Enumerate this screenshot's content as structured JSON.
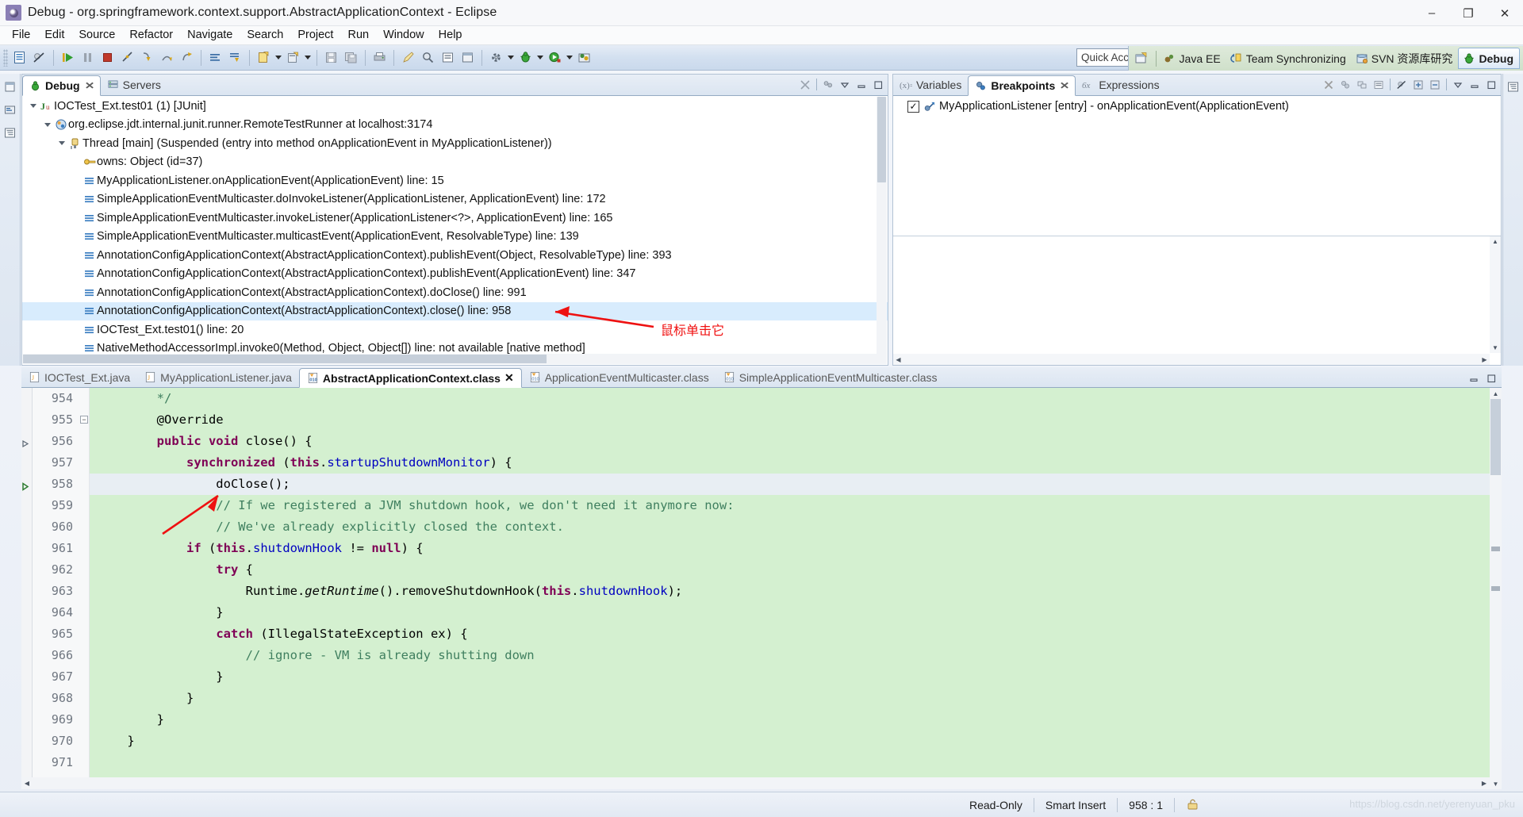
{
  "window": {
    "title": "Debug - org.springframework.context.support.AbstractApplicationContext - Eclipse",
    "app_icon": "eclipse-icon",
    "minimize": "minimize-icon",
    "maximize": "maximize-icon",
    "close": "close-icon",
    "min_glyph": "–",
    "max_glyph": "❐",
    "close_glyph": "✕"
  },
  "menu": {
    "items": [
      {
        "label": "File"
      },
      {
        "label": "Edit"
      },
      {
        "label": "Source"
      },
      {
        "label": "Refactor"
      },
      {
        "label": "Navigate"
      },
      {
        "label": "Search"
      },
      {
        "label": "Project"
      },
      {
        "label": "Run"
      },
      {
        "label": "Window"
      },
      {
        "label": "Help"
      }
    ]
  },
  "toolbar": {
    "quick_access": "Quick Access",
    "quick_access_placeholder": "Quick Access",
    "buttons": [
      {
        "name": "new-wizard-button",
        "icon": "new-file-icon"
      },
      {
        "name": "skip-breakpoints-button",
        "icon": "skip-breakpoints-icon"
      },
      {
        "name": "resume-button",
        "icon": "resume-icon"
      },
      {
        "name": "suspend-button",
        "icon": "suspend-icon"
      },
      {
        "name": "terminate-button",
        "icon": "terminate-stop-icon"
      },
      {
        "name": "disconnect-button",
        "icon": "disconnect-icon"
      },
      {
        "name": "step-into-button",
        "icon": "step-into-icon"
      },
      {
        "name": "step-over-button",
        "icon": "step-over-icon"
      },
      {
        "name": "step-return-button",
        "icon": "step-return-icon"
      },
      {
        "name": "align-button",
        "icon": "lines-icon"
      },
      {
        "name": "drop-to-frame-button",
        "icon": "drop-to-frame-icon"
      },
      {
        "name": "new-java-class-button",
        "icon": "new-class-icon"
      },
      {
        "name": "new-java-package-button",
        "icon": "new-package-icon"
      },
      {
        "name": "save-button",
        "icon": "save-disk-icon"
      },
      {
        "name": "save-all-button",
        "icon": "save-all-icon"
      },
      {
        "name": "print-button",
        "icon": "print-icon"
      },
      {
        "name": "quick-fix-button",
        "icon": "pencil-icon"
      },
      {
        "name": "search-button",
        "icon": "search-icon"
      },
      {
        "name": "open-task-button",
        "icon": "task-icon"
      },
      {
        "name": "open-type-button",
        "icon": "type-icon"
      },
      {
        "name": "debug-launch-button",
        "icon": "debug-bug-icon"
      },
      {
        "name": "run-launch-button",
        "icon": "run-green-play-icon"
      },
      {
        "name": "external-tools-button",
        "icon": "external-tools-icon"
      },
      {
        "name": "open-perspective-button",
        "icon": "open-perspective-icon"
      }
    ]
  },
  "perspectives": {
    "open_button": "open-perspective-icon",
    "items": [
      {
        "label": "Java EE",
        "icon": "java-ee-icon",
        "active": false
      },
      {
        "label": "Team Synchronizing",
        "icon": "team-sync-icon",
        "active": false
      },
      {
        "label": "SVN 资源库研究",
        "icon": "svn-repo-icon",
        "active": false
      },
      {
        "label": "Debug",
        "icon": "debug-bug-icon",
        "active": true
      }
    ]
  },
  "fast_view_bar": {
    "buttons": [
      {
        "name": "restore-view-icon"
      },
      {
        "name": "package-explorer-icon"
      },
      {
        "name": "outline-icon"
      }
    ]
  },
  "right_bar": {
    "buttons": [
      {
        "name": "outline-view-icon"
      }
    ]
  },
  "debug_view": {
    "tabs": [
      {
        "label": "Debug",
        "icon": "debug-bug-icon",
        "active": true,
        "closeable": true
      },
      {
        "label": "Servers",
        "icon": "servers-icon",
        "active": false,
        "closeable": false
      }
    ],
    "tools": [
      {
        "name": "collapse-all-icon"
      },
      {
        "name": "view-menu-icon"
      },
      {
        "name": "minimize-view-icon"
      },
      {
        "name": "maximize-view-icon"
      }
    ],
    "tree": [
      {
        "indent": 0,
        "twisty": "open",
        "icon": "junit-launch-icon",
        "label": "IOCTest_Ext.test01 (1) [JUnit]",
        "selected": false
      },
      {
        "indent": 1,
        "twisty": "open",
        "icon": "java-process-icon",
        "label": "org.eclipse.jdt.internal.junit.runner.RemoteTestRunner at localhost:3174",
        "selected": false
      },
      {
        "indent": 2,
        "twisty": "open",
        "icon": "thread-suspended-icon",
        "label": "Thread [main] (Suspended (entry into method onApplicationEvent in MyApplicationListener))",
        "selected": false
      },
      {
        "indent": 3,
        "twisty": "none",
        "icon": "monitor-owns-icon",
        "label": "owns: Object  (id=37)",
        "selected": false
      },
      {
        "indent": 3,
        "twisty": "none",
        "icon": "stack-frame-icon",
        "label": "MyApplicationListener.onApplicationEvent(ApplicationEvent) line: 15",
        "selected": false
      },
      {
        "indent": 3,
        "twisty": "none",
        "icon": "stack-frame-icon",
        "label": "SimpleApplicationEventMulticaster.doInvokeListener(ApplicationListener, ApplicationEvent) line: 172",
        "selected": false
      },
      {
        "indent": 3,
        "twisty": "none",
        "icon": "stack-frame-icon",
        "label": "SimpleApplicationEventMulticaster.invokeListener(ApplicationListener<?>, ApplicationEvent) line: 165",
        "selected": false
      },
      {
        "indent": 3,
        "twisty": "none",
        "icon": "stack-frame-icon",
        "label": "SimpleApplicationEventMulticaster.multicastEvent(ApplicationEvent, ResolvableType) line: 139",
        "selected": false
      },
      {
        "indent": 3,
        "twisty": "none",
        "icon": "stack-frame-icon",
        "label": "AnnotationConfigApplicationContext(AbstractApplicationContext).publishEvent(Object, ResolvableType) line: 393",
        "selected": false
      },
      {
        "indent": 3,
        "twisty": "none",
        "icon": "stack-frame-icon",
        "label": "AnnotationConfigApplicationContext(AbstractApplicationContext).publishEvent(ApplicationEvent) line: 347",
        "selected": false
      },
      {
        "indent": 3,
        "twisty": "none",
        "icon": "stack-frame-icon",
        "label": "AnnotationConfigApplicationContext(AbstractApplicationContext).doClose() line: 991",
        "selected": false
      },
      {
        "indent": 3,
        "twisty": "none",
        "icon": "stack-frame-icon",
        "label": "AnnotationConfigApplicationContext(AbstractApplicationContext).close() line: 958",
        "selected": true
      },
      {
        "indent": 3,
        "twisty": "none",
        "icon": "stack-frame-icon",
        "label": "IOCTest_Ext.test01() line: 20",
        "selected": false
      },
      {
        "indent": 3,
        "twisty": "none",
        "icon": "stack-frame-icon",
        "label": "NativeMethodAccessorImpl.invoke0(Method, Object, Object[]) line: not available [native method]",
        "selected": false
      }
    ]
  },
  "breakpoints_view": {
    "tabs": [
      {
        "label": "Variables",
        "icon": "variables-icon",
        "active": false,
        "closeable": false
      },
      {
        "label": "Breakpoints",
        "icon": "breakpoints-icon",
        "active": true,
        "closeable": true
      },
      {
        "label": "Expressions",
        "icon": "expressions-icon",
        "active": false,
        "closeable": false
      }
    ],
    "tools": [
      {
        "name": "remove-breakpoint-icon"
      },
      {
        "name": "remove-all-breakpoints-icon"
      },
      {
        "name": "link-with-debug-view-icon"
      },
      {
        "name": "breakpoint-group-icon"
      },
      {
        "name": "skip-all-breakpoints-icon"
      },
      {
        "name": "expand-all-icon"
      },
      {
        "name": "collapse-all-icon"
      },
      {
        "name": "view-menu-icon"
      },
      {
        "name": "minimize-view-icon"
      },
      {
        "name": "maximize-view-icon"
      }
    ],
    "items": [
      {
        "checked": true,
        "check_glyph": "✓",
        "icon": "method-breakpoint-icon",
        "label": "MyApplicationListener [entry] - onApplicationEvent(ApplicationEvent)"
      }
    ]
  },
  "editor": {
    "tabs": [
      {
        "label": "IOCTest_Ext.java",
        "icon": "java-file-icon",
        "active": false,
        "closeable": false
      },
      {
        "label": "MyApplicationListener.java",
        "icon": "java-file-icon",
        "active": false,
        "closeable": false
      },
      {
        "label": "AbstractApplicationContext.class",
        "icon": "class-file-icon",
        "active": true,
        "closeable": true
      },
      {
        "label": "ApplicationEventMulticaster.class",
        "icon": "class-file-icon",
        "active": false,
        "closeable": false
      },
      {
        "label": "SimpleApplicationEventMulticaster.class",
        "icon": "class-file-icon",
        "active": false,
        "closeable": false
      }
    ],
    "tools": [
      {
        "name": "minimize-editor-icon"
      },
      {
        "name": "maximize-editor-icon"
      }
    ],
    "first_line": 954,
    "current_line": 958,
    "lines": [
      {
        "no": 954,
        "fold": "none",
        "marker": "none",
        "tokens": [
          {
            "t": "        ",
            "c": "pl"
          },
          {
            "t": "*/",
            "c": "cm"
          }
        ]
      },
      {
        "no": 955,
        "fold": "minus",
        "marker": "none",
        "tokens": [
          {
            "t": "        @Override",
            "c": "pl"
          }
        ]
      },
      {
        "no": 956,
        "fold": "none",
        "marker": "collapse",
        "tokens": [
          {
            "t": "        ",
            "c": "pl"
          },
          {
            "t": "public void ",
            "c": "kw"
          },
          {
            "t": "close() {",
            "c": "pl"
          }
        ]
      },
      {
        "no": 957,
        "fold": "none",
        "marker": "none",
        "tokens": [
          {
            "t": "            ",
            "c": "pl"
          },
          {
            "t": "synchronized ",
            "c": "kw"
          },
          {
            "t": "(",
            "c": "pl"
          },
          {
            "t": "this",
            "c": "kw"
          },
          {
            "t": ".",
            "c": "pl"
          },
          {
            "t": "startupShutdownMonitor",
            "c": "fld"
          },
          {
            "t": ") {",
            "c": "pl"
          }
        ]
      },
      {
        "no": 958,
        "fold": "none",
        "marker": "arrow",
        "current": true,
        "tokens": [
          {
            "t": "                doClose();",
            "c": "pl"
          }
        ]
      },
      {
        "no": 959,
        "fold": "none",
        "marker": "none",
        "tokens": [
          {
            "t": "                ",
            "c": "pl"
          },
          {
            "t": "// If we registered a JVM shutdown hook, we don't need it anymore now:",
            "c": "cm"
          }
        ]
      },
      {
        "no": 960,
        "fold": "none",
        "marker": "none",
        "tokens": [
          {
            "t": "                ",
            "c": "pl"
          },
          {
            "t": "// We've already explicitly closed the context.",
            "c": "cm"
          }
        ]
      },
      {
        "no": 961,
        "fold": "none",
        "marker": "none",
        "tokens": [
          {
            "t": "            ",
            "c": "pl"
          },
          {
            "t": "if ",
            "c": "kw"
          },
          {
            "t": "(",
            "c": "pl"
          },
          {
            "t": "this",
            "c": "kw"
          },
          {
            "t": ".",
            "c": "pl"
          },
          {
            "t": "shutdownHook",
            "c": "fld"
          },
          {
            "t": " != ",
            "c": "pl"
          },
          {
            "t": "null",
            "c": "kw"
          },
          {
            "t": ") {",
            "c": "pl"
          }
        ]
      },
      {
        "no": 962,
        "fold": "none",
        "marker": "none",
        "tokens": [
          {
            "t": "                ",
            "c": "pl"
          },
          {
            "t": "try ",
            "c": "kw"
          },
          {
            "t": "{",
            "c": "pl"
          }
        ]
      },
      {
        "no": 963,
        "fold": "none",
        "marker": "none",
        "tokens": [
          {
            "t": "                    Runtime.",
            "c": "pl"
          },
          {
            "t": "getRuntime",
            "c": "mth"
          },
          {
            "t": "().removeShutdownHook(",
            "c": "pl"
          },
          {
            "t": "this",
            "c": "kw"
          },
          {
            "t": ".",
            "c": "pl"
          },
          {
            "t": "shutdownHook",
            "c": "fld"
          },
          {
            "t": ");",
            "c": "pl"
          }
        ]
      },
      {
        "no": 964,
        "fold": "none",
        "marker": "none",
        "tokens": [
          {
            "t": "                }",
            "c": "pl"
          }
        ]
      },
      {
        "no": 965,
        "fold": "none",
        "marker": "none",
        "tokens": [
          {
            "t": "                ",
            "c": "pl"
          },
          {
            "t": "catch ",
            "c": "kw"
          },
          {
            "t": "(IllegalStateException ex) {",
            "c": "pl"
          }
        ]
      },
      {
        "no": 966,
        "fold": "none",
        "marker": "none",
        "tokens": [
          {
            "t": "                    ",
            "c": "pl"
          },
          {
            "t": "// ignore - VM is already shutting down",
            "c": "cm"
          }
        ]
      },
      {
        "no": 967,
        "fold": "none",
        "marker": "none",
        "tokens": [
          {
            "t": "                }",
            "c": "pl"
          }
        ]
      },
      {
        "no": 968,
        "fold": "none",
        "marker": "none",
        "tokens": [
          {
            "t": "            }",
            "c": "pl"
          }
        ]
      },
      {
        "no": 969,
        "fold": "none",
        "marker": "none",
        "tokens": [
          {
            "t": "        }",
            "c": "pl"
          }
        ]
      },
      {
        "no": 970,
        "fold": "none",
        "marker": "none",
        "tokens": [
          {
            "t": "    }",
            "c": "pl"
          }
        ]
      },
      {
        "no": 971,
        "fold": "none",
        "marker": "none",
        "tokens": [
          {
            "t": "",
            "c": "pl"
          }
        ]
      }
    ]
  },
  "status_bar": {
    "read_only": "Read-Only",
    "insert_mode": "Smart Insert",
    "cursor_position": "958 : 1",
    "lock_icon": "writable-lock-icon",
    "watermark": "https://blog.csdn.net/yerenyuan_pku"
  },
  "annotations": [
    {
      "name": "annotation-click-stack-frame",
      "text": "鼠标单击它",
      "color": "#f01010"
    },
    {
      "name": "annotation-arrow-to-code",
      "text": "",
      "color": "#e31010"
    }
  ],
  "colors": {
    "accent": "#3c6eb4",
    "selection": "#d8ecfd",
    "code_background": "#d4f0d0",
    "current_line": "#e8eef3",
    "annotation_red": "#f01010",
    "keyword": "#7f0055",
    "field": "#0000c0",
    "comment": "#3f7f5f"
  }
}
